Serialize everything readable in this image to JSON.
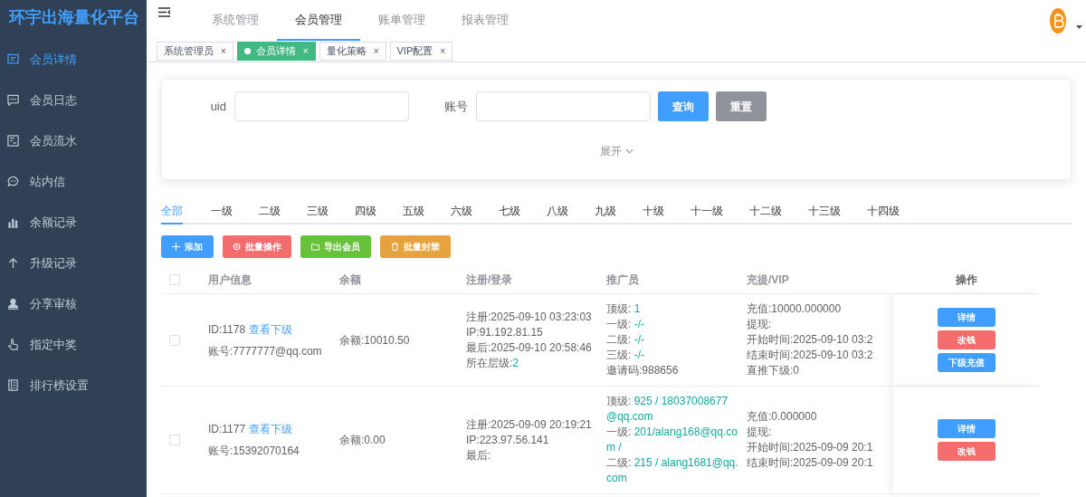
{
  "sidebar": {
    "title": "环宇出海量化平台",
    "items": [
      {
        "label": "会员详情",
        "selected": true
      },
      {
        "label": "会员日志",
        "selected": false
      },
      {
        "label": "会员流水",
        "selected": false
      },
      {
        "label": "站内信",
        "selected": false
      },
      {
        "label": "余额记录",
        "selected": false
      },
      {
        "label": "升级记录",
        "selected": false
      },
      {
        "label": "分享审核",
        "selected": false
      },
      {
        "label": "指定中奖",
        "selected": false
      },
      {
        "label": "排行榜设置",
        "selected": false
      }
    ]
  },
  "header": {
    "nav": [
      {
        "label": "系统管理",
        "selected": false
      },
      {
        "label": "会员管理",
        "selected": true
      },
      {
        "label": "账单管理",
        "selected": false
      },
      {
        "label": "报表管理",
        "selected": false
      }
    ]
  },
  "tags": [
    {
      "label": "系统管理员",
      "selected": false,
      "close": "×"
    },
    {
      "label": "会员详情",
      "selected": true,
      "close": "×"
    },
    {
      "label": "量化策略",
      "selected": false,
      "close": "×"
    },
    {
      "label": "VIP配置",
      "selected": false,
      "close": "×"
    }
  ],
  "search": {
    "fields": [
      {
        "label": "uid"
      },
      {
        "label": "账号"
      }
    ],
    "buttons": [
      {
        "label": "查询",
        "kind": "primary"
      },
      {
        "label": "重置",
        "kind": "reset"
      }
    ],
    "expand": "展开"
  },
  "level_tabs": [
    {
      "label": "全部",
      "selected": true
    },
    {
      "label": "一级",
      "selected": false
    },
    {
      "label": "二级",
      "selected": false
    },
    {
      "label": "三级",
      "selected": false
    },
    {
      "label": "四级",
      "selected": false
    },
    {
      "label": "五级",
      "selected": false
    },
    {
      "label": "六级",
      "selected": false
    },
    {
      "label": "七级",
      "selected": false
    },
    {
      "label": "八级",
      "selected": false
    },
    {
      "label": "九级",
      "selected": false
    },
    {
      "label": "十级",
      "selected": false
    },
    {
      "label": "十一级",
      "selected": false
    },
    {
      "label": "十二级",
      "selected": false
    },
    {
      "label": "十三级",
      "selected": false
    },
    {
      "label": "十四级",
      "selected": false
    }
  ],
  "actions": [
    {
      "label": "添加",
      "kind": "add"
    },
    {
      "label": "批量操作",
      "kind": "batch"
    },
    {
      "label": "导出会员",
      "kind": "export"
    },
    {
      "label": "批量封禁",
      "kind": "ban"
    }
  ],
  "table": {
    "select_all_checked": false,
    "columns": [
      "用户信息",
      "余额",
      "注册/登录",
      "推广员",
      "充提/VIP",
      "操作"
    ],
    "rows": [
      {
        "checked": false,
        "id": "ID:1178",
        "link": "查看下级",
        "account": "账号:7777777@qq.com",
        "balance": "余额:10010.50",
        "register": [
          {
            "label": "注册:2025-09-10 03:23:03"
          },
          {
            "label": "IP:91.192.81.15"
          },
          {
            "label": "最后:2025-09-10 20:58:46"
          },
          {
            "label": "所在层级:",
            "value": "2"
          }
        ],
        "promoter": [
          {
            "label": "顶级: ",
            "value": "1"
          },
          {
            "label": "一级: ",
            "value": "-/-"
          },
          {
            "label": "二级: ",
            "value": "-/-"
          },
          {
            "label": "三级: ",
            "value": "-/-"
          },
          {
            "label": "邀请码:988656"
          }
        ],
        "vip": [
          "充值:10000.000000",
          "提现:",
          "开始时间:2025-09-10 03:2",
          "结束时间:2025-09-10 03:2",
          "直推下级:0"
        ],
        "buttons": [
          {
            "label": "详情",
            "kind": "detail"
          },
          {
            "label": "改钱",
            "kind": "money"
          },
          {
            "label": "下级充值",
            "kind": "recharge"
          }
        ]
      },
      {
        "checked": false,
        "id": "ID:1177",
        "link": "查看下级",
        "account": "账号:15392070164",
        "balance": "余额:0.00",
        "register": [
          {
            "label": "注册:2025-09-09 20:19:21"
          },
          {
            "label": "IP:223.97.56.141"
          },
          {
            "label": "最后:"
          }
        ],
        "promoter": [
          {
            "label": "顶级: ",
            "value": "925 / 18037008677@qq.com"
          },
          {
            "label": "一级: ",
            "value": "201/alang168@qq.com /"
          },
          {
            "label": "二级: ",
            "value": "215 / alang1681@qq.com"
          }
        ],
        "vip": [
          "充值:0.000000",
          "提现:",
          "开始时间:2025-09-09 20:1",
          "结束时间:2025-09-09 20:1"
        ],
        "buttons": [
          {
            "label": "详情",
            "kind": "detail"
          },
          {
            "label": "改钱",
            "kind": "money"
          }
        ]
      }
    ]
  }
}
